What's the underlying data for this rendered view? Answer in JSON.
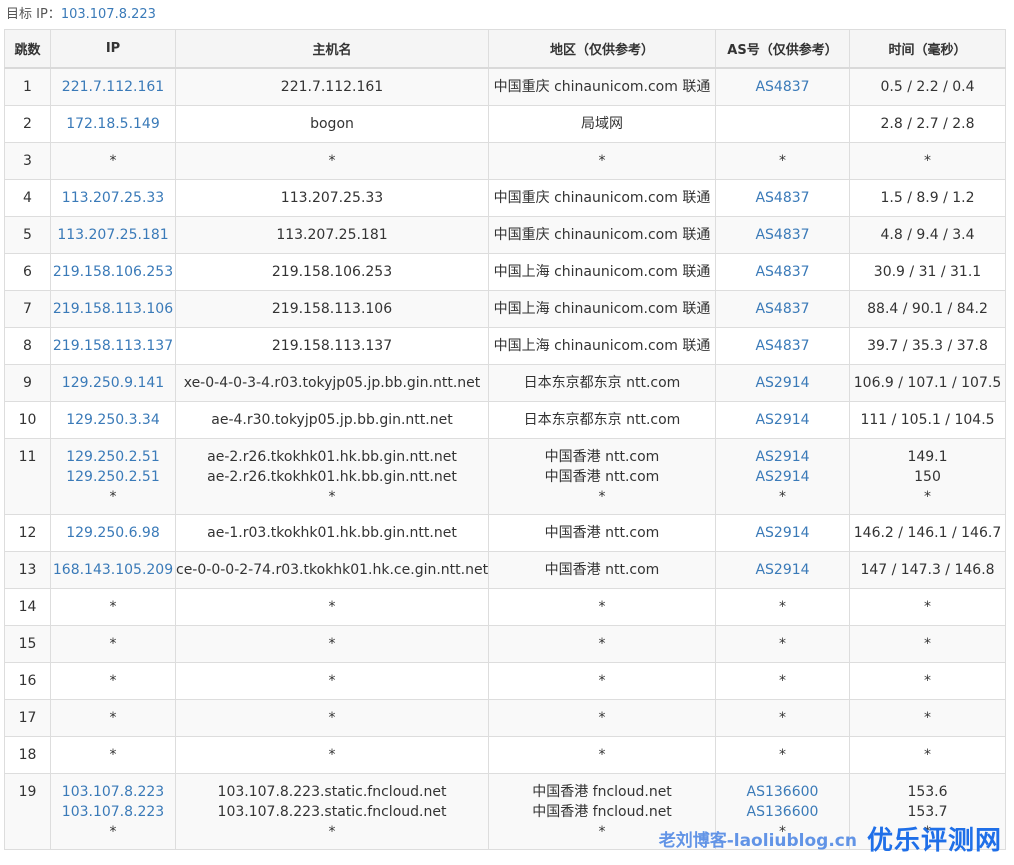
{
  "target": {
    "label": "目标 IP：",
    "ip": "103.107.8.223"
  },
  "headers": [
    "跳数",
    "IP",
    "主机名",
    "地区（仅供参考）",
    "AS号（仅供参考）",
    "时间（毫秒）"
  ],
  "rows": [
    {
      "hop": "1",
      "ip": [
        "221.7.112.161"
      ],
      "host": [
        "221.7.112.161"
      ],
      "region": [
        "中国重庆 chinaunicom.com 联通"
      ],
      "as": [
        "AS4837"
      ],
      "time": [
        "0.5 / 2.2 / 0.4"
      ]
    },
    {
      "hop": "2",
      "ip": [
        "172.18.5.149"
      ],
      "host": [
        "bogon"
      ],
      "region": [
        "局域网"
      ],
      "as": [
        ""
      ],
      "time": [
        "2.8 / 2.7 / 2.8"
      ]
    },
    {
      "hop": "3",
      "ip": [
        "*"
      ],
      "host": [
        "*"
      ],
      "region": [
        "*"
      ],
      "as": [
        "*"
      ],
      "time": [
        "*"
      ]
    },
    {
      "hop": "4",
      "ip": [
        "113.207.25.33"
      ],
      "host": [
        "113.207.25.33"
      ],
      "region": [
        "中国重庆 chinaunicom.com 联通"
      ],
      "as": [
        "AS4837"
      ],
      "time": [
        "1.5 / 8.9 / 1.2"
      ]
    },
    {
      "hop": "5",
      "ip": [
        "113.207.25.181"
      ],
      "host": [
        "113.207.25.181"
      ],
      "region": [
        "中国重庆 chinaunicom.com 联通"
      ],
      "as": [
        "AS4837"
      ],
      "time": [
        "4.8 / 9.4 / 3.4"
      ]
    },
    {
      "hop": "6",
      "ip": [
        "219.158.106.253"
      ],
      "host": [
        "219.158.106.253"
      ],
      "region": [
        "中国上海 chinaunicom.com 联通"
      ],
      "as": [
        "AS4837"
      ],
      "time": [
        "30.9 / 31 / 31.1"
      ]
    },
    {
      "hop": "7",
      "ip": [
        "219.158.113.106"
      ],
      "host": [
        "219.158.113.106"
      ],
      "region": [
        "中国上海 chinaunicom.com 联通"
      ],
      "as": [
        "AS4837"
      ],
      "time": [
        "88.4 / 90.1 / 84.2"
      ]
    },
    {
      "hop": "8",
      "ip": [
        "219.158.113.137"
      ],
      "host": [
        "219.158.113.137"
      ],
      "region": [
        "中国上海 chinaunicom.com 联通"
      ],
      "as": [
        "AS4837"
      ],
      "time": [
        "39.7 / 35.3 / 37.8"
      ]
    },
    {
      "hop": "9",
      "ip": [
        "129.250.9.141"
      ],
      "host": [
        "xe-0-4-0-3-4.r03.tokyjp05.jp.bb.gin.ntt.net"
      ],
      "region": [
        "日本东京都东京 ntt.com"
      ],
      "as": [
        "AS2914"
      ],
      "time": [
        "106.9 / 107.1 / 107.5"
      ]
    },
    {
      "hop": "10",
      "ip": [
        "129.250.3.34"
      ],
      "host": [
        "ae-4.r30.tokyjp05.jp.bb.gin.ntt.net"
      ],
      "region": [
        "日本东京都东京 ntt.com"
      ],
      "as": [
        "AS2914"
      ],
      "time": [
        "111 / 105.1 / 104.5"
      ]
    },
    {
      "hop": "11",
      "ip": [
        "129.250.2.51",
        "129.250.2.51",
        "*"
      ],
      "host": [
        "ae-2.r26.tkokhk01.hk.bb.gin.ntt.net",
        "ae-2.r26.tkokhk01.hk.bb.gin.ntt.net",
        "*"
      ],
      "region": [
        "中国香港 ntt.com",
        "中国香港 ntt.com",
        "*"
      ],
      "as": [
        "AS2914",
        "AS2914",
        "*"
      ],
      "time": [
        "149.1",
        "150",
        "*"
      ]
    },
    {
      "hop": "12",
      "ip": [
        "129.250.6.98"
      ],
      "host": [
        "ae-1.r03.tkokhk01.hk.bb.gin.ntt.net"
      ],
      "region": [
        "中国香港 ntt.com"
      ],
      "as": [
        "AS2914"
      ],
      "time": [
        "146.2 / 146.1 / 146.7"
      ]
    },
    {
      "hop": "13",
      "ip": [
        "168.143.105.209"
      ],
      "host": [
        "ce-0-0-0-2-74.r03.tkokhk01.hk.ce.gin.ntt.net"
      ],
      "region": [
        "中国香港 ntt.com"
      ],
      "as": [
        "AS2914"
      ],
      "time": [
        "147 / 147.3 / 146.8"
      ]
    },
    {
      "hop": "14",
      "ip": [
        "*"
      ],
      "host": [
        "*"
      ],
      "region": [
        "*"
      ],
      "as": [
        "*"
      ],
      "time": [
        "*"
      ]
    },
    {
      "hop": "15",
      "ip": [
        "*"
      ],
      "host": [
        "*"
      ],
      "region": [
        "*"
      ],
      "as": [
        "*"
      ],
      "time": [
        "*"
      ]
    },
    {
      "hop": "16",
      "ip": [
        "*"
      ],
      "host": [
        "*"
      ],
      "region": [
        "*"
      ],
      "as": [
        "*"
      ],
      "time": [
        "*"
      ]
    },
    {
      "hop": "17",
      "ip": [
        "*"
      ],
      "host": [
        "*"
      ],
      "region": [
        "*"
      ],
      "as": [
        "*"
      ],
      "time": [
        "*"
      ]
    },
    {
      "hop": "18",
      "ip": [
        "*"
      ],
      "host": [
        "*"
      ],
      "region": [
        "*"
      ],
      "as": [
        "*"
      ],
      "time": [
        "*"
      ]
    },
    {
      "hop": "19",
      "ip": [
        "103.107.8.223",
        "103.107.8.223",
        "*"
      ],
      "host": [
        "103.107.8.223.static.fncloud.net",
        "103.107.8.223.static.fncloud.net",
        "*"
      ],
      "region": [
        "中国香港 fncloud.net",
        "中国香港 fncloud.net",
        "*"
      ],
      "as": [
        "AS136600",
        "AS136600",
        "*"
      ],
      "time": [
        "153.6",
        "153.7",
        "*"
      ]
    }
  ],
  "watermark": {
    "small": "老刘博客-laoliublog.cn",
    "big": "优乐评测网"
  },
  "colors": {
    "link": "#3a7ab8",
    "header_bg": "#f5f5f5",
    "stripe": "#f9f9f9",
    "border": "#dddddd",
    "watermark": "#1f6fe8"
  }
}
